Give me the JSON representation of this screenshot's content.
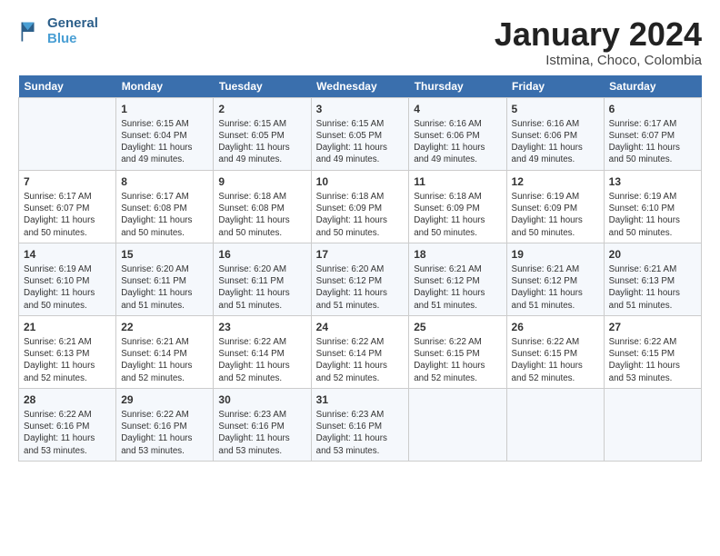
{
  "header": {
    "logo_line1": "General",
    "logo_line2": "Blue",
    "month_title": "January 2024",
    "subtitle": "Istmina, Choco, Colombia"
  },
  "weekdays": [
    "Sunday",
    "Monday",
    "Tuesday",
    "Wednesday",
    "Thursday",
    "Friday",
    "Saturday"
  ],
  "weeks": [
    [
      {
        "day": "",
        "info": ""
      },
      {
        "day": "1",
        "info": "Sunrise: 6:15 AM\nSunset: 6:04 PM\nDaylight: 11 hours\nand 49 minutes."
      },
      {
        "day": "2",
        "info": "Sunrise: 6:15 AM\nSunset: 6:05 PM\nDaylight: 11 hours\nand 49 minutes."
      },
      {
        "day": "3",
        "info": "Sunrise: 6:15 AM\nSunset: 6:05 PM\nDaylight: 11 hours\nand 49 minutes."
      },
      {
        "day": "4",
        "info": "Sunrise: 6:16 AM\nSunset: 6:06 PM\nDaylight: 11 hours\nand 49 minutes."
      },
      {
        "day": "5",
        "info": "Sunrise: 6:16 AM\nSunset: 6:06 PM\nDaylight: 11 hours\nand 49 minutes."
      },
      {
        "day": "6",
        "info": "Sunrise: 6:17 AM\nSunset: 6:07 PM\nDaylight: 11 hours\nand 50 minutes."
      }
    ],
    [
      {
        "day": "7",
        "info": "Sunrise: 6:17 AM\nSunset: 6:07 PM\nDaylight: 11 hours\nand 50 minutes."
      },
      {
        "day": "8",
        "info": "Sunrise: 6:17 AM\nSunset: 6:08 PM\nDaylight: 11 hours\nand 50 minutes."
      },
      {
        "day": "9",
        "info": "Sunrise: 6:18 AM\nSunset: 6:08 PM\nDaylight: 11 hours\nand 50 minutes."
      },
      {
        "day": "10",
        "info": "Sunrise: 6:18 AM\nSunset: 6:09 PM\nDaylight: 11 hours\nand 50 minutes."
      },
      {
        "day": "11",
        "info": "Sunrise: 6:18 AM\nSunset: 6:09 PM\nDaylight: 11 hours\nand 50 minutes."
      },
      {
        "day": "12",
        "info": "Sunrise: 6:19 AM\nSunset: 6:09 PM\nDaylight: 11 hours\nand 50 minutes."
      },
      {
        "day": "13",
        "info": "Sunrise: 6:19 AM\nSunset: 6:10 PM\nDaylight: 11 hours\nand 50 minutes."
      }
    ],
    [
      {
        "day": "14",
        "info": "Sunrise: 6:19 AM\nSunset: 6:10 PM\nDaylight: 11 hours\nand 50 minutes."
      },
      {
        "day": "15",
        "info": "Sunrise: 6:20 AM\nSunset: 6:11 PM\nDaylight: 11 hours\nand 51 minutes."
      },
      {
        "day": "16",
        "info": "Sunrise: 6:20 AM\nSunset: 6:11 PM\nDaylight: 11 hours\nand 51 minutes."
      },
      {
        "day": "17",
        "info": "Sunrise: 6:20 AM\nSunset: 6:12 PM\nDaylight: 11 hours\nand 51 minutes."
      },
      {
        "day": "18",
        "info": "Sunrise: 6:21 AM\nSunset: 6:12 PM\nDaylight: 11 hours\nand 51 minutes."
      },
      {
        "day": "19",
        "info": "Sunrise: 6:21 AM\nSunset: 6:12 PM\nDaylight: 11 hours\nand 51 minutes."
      },
      {
        "day": "20",
        "info": "Sunrise: 6:21 AM\nSunset: 6:13 PM\nDaylight: 11 hours\nand 51 minutes."
      }
    ],
    [
      {
        "day": "21",
        "info": "Sunrise: 6:21 AM\nSunset: 6:13 PM\nDaylight: 11 hours\nand 52 minutes."
      },
      {
        "day": "22",
        "info": "Sunrise: 6:21 AM\nSunset: 6:14 PM\nDaylight: 11 hours\nand 52 minutes."
      },
      {
        "day": "23",
        "info": "Sunrise: 6:22 AM\nSunset: 6:14 PM\nDaylight: 11 hours\nand 52 minutes."
      },
      {
        "day": "24",
        "info": "Sunrise: 6:22 AM\nSunset: 6:14 PM\nDaylight: 11 hours\nand 52 minutes."
      },
      {
        "day": "25",
        "info": "Sunrise: 6:22 AM\nSunset: 6:15 PM\nDaylight: 11 hours\nand 52 minutes."
      },
      {
        "day": "26",
        "info": "Sunrise: 6:22 AM\nSunset: 6:15 PM\nDaylight: 11 hours\nand 52 minutes."
      },
      {
        "day": "27",
        "info": "Sunrise: 6:22 AM\nSunset: 6:15 PM\nDaylight: 11 hours\nand 53 minutes."
      }
    ],
    [
      {
        "day": "28",
        "info": "Sunrise: 6:22 AM\nSunset: 6:16 PM\nDaylight: 11 hours\nand 53 minutes."
      },
      {
        "day": "29",
        "info": "Sunrise: 6:22 AM\nSunset: 6:16 PM\nDaylight: 11 hours\nand 53 minutes."
      },
      {
        "day": "30",
        "info": "Sunrise: 6:23 AM\nSunset: 6:16 PM\nDaylight: 11 hours\nand 53 minutes."
      },
      {
        "day": "31",
        "info": "Sunrise: 6:23 AM\nSunset: 6:16 PM\nDaylight: 11 hours\nand 53 minutes."
      },
      {
        "day": "",
        "info": ""
      },
      {
        "day": "",
        "info": ""
      },
      {
        "day": "",
        "info": ""
      }
    ]
  ]
}
